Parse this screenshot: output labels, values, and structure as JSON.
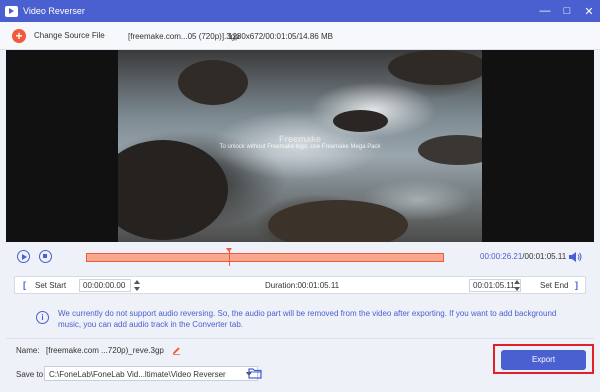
{
  "window": {
    "title": "Video Reverser",
    "controls": [
      "—",
      "□",
      "✕"
    ]
  },
  "toolbar": {
    "change_source_label": "Change Source File",
    "file_name": "[freemake.com...05 (720p)].3gp",
    "file_info": "1280x672/00:01:05/14.86 MB"
  },
  "preview": {
    "watermark_logo": "Freemake",
    "watermark_text": "To unlock without Freemake logo, use Freemake Mega Pack"
  },
  "playback": {
    "current_time": "00:00:26.21",
    "total_time": "/00:01:05.11",
    "playhead_fraction": 0.4
  },
  "trim": {
    "set_start_label": "Set Start",
    "start_time": "00:00:00.00",
    "duration": "Duration:00:01:05.11",
    "end_time": "00:01:05.11",
    "set_end_label": "Set End"
  },
  "notice": {
    "icon": "i",
    "text": "We currently do not support audio reversing. So, the audio part will be removed from the video after exporting. If you want to add background music, you can add audio track in the Converter tab."
  },
  "output": {
    "name_label": "Name:",
    "name_value": "[freemake.com ...720p)_reve.3gp",
    "save_label": "Save to:",
    "save_path": "C:\\FoneLab\\FoneLab Vid...ltimate\\Video Reverser",
    "export_label": "Export"
  },
  "colors": {
    "accent": "#4a5fd0",
    "track": "#f7a88f",
    "highlight": "#e0202a",
    "add_icon": "#f15a3a"
  }
}
